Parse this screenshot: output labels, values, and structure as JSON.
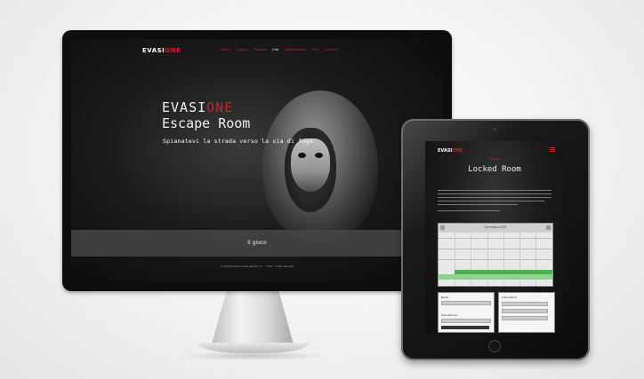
{
  "imac": {
    "logo_main": "EVASI",
    "logo_accent": "ONE",
    "menu": [
      {
        "label": "Home"
      },
      {
        "label": "Il gioco"
      },
      {
        "label": "Prenota"
      },
      {
        "label": "Info"
      },
      {
        "label": "Regolamento"
      },
      {
        "label": "FAQ"
      },
      {
        "label": "Contatti"
      }
    ],
    "hero": {
      "brand_main": "EVASI",
      "brand_accent": "ONE",
      "title": "Escape Room",
      "tagline": "Spianatevi la strada verso la via di fuga",
      "button": "Il gioco"
    },
    "footer": "© 2018 Evasione Escape Room — tutti i diritti riservati"
  },
  "ipad": {
    "logo_main": "EVASI",
    "logo_accent": "ONE",
    "subtitle": "Prenota",
    "room_title": "Locked Room",
    "calendar_title": "Gennaio 2019",
    "form_a_label": "Nome",
    "form_a_label2": "Prenotazione",
    "form_b_label": "Informazioni"
  },
  "colors": {
    "accent": "#d0202a",
    "screen_bg": "#0a0a0a",
    "page_bg": "#f2f2f2"
  }
}
